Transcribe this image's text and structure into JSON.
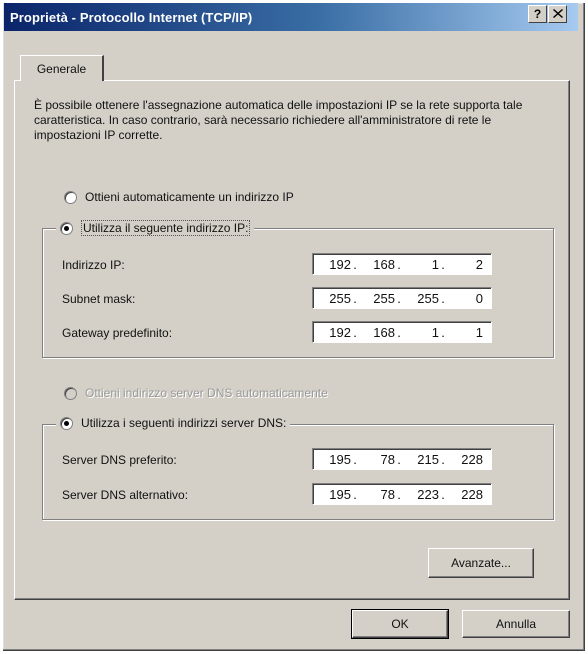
{
  "window": {
    "title": "Proprietà - Protocollo Internet (TCP/IP)",
    "help_label": "?",
    "close_label": "X"
  },
  "tabs": [
    {
      "label": "Generale"
    }
  ],
  "description": "È possibile ottenere l'assegnazione automatica delle impostazioni IP se la rete supporta tale caratteristica. In caso contrario, sarà necessario richiedere all'amministratore di rete le impostazioni IP corrette.",
  "ip": {
    "auto_option": "Ottieni automaticamente un indirizzo IP",
    "manual_option": "Utilizza il seguente indirizzo IP:",
    "selected": "manual",
    "fields": [
      {
        "label": "Indirizzo IP:",
        "octets": [
          "192",
          "168",
          "1",
          "2"
        ]
      },
      {
        "label": "Subnet mask:",
        "octets": [
          "255",
          "255",
          "255",
          "0"
        ]
      },
      {
        "label": "Gateway predefinito:",
        "octets": [
          "192",
          "168",
          "1",
          "1"
        ]
      }
    ]
  },
  "dns": {
    "auto_option": "Ottieni indirizzo server DNS automaticamente",
    "manual_option": "Utilizza i seguenti indirizzi server DNS:",
    "selected": "manual",
    "fields": [
      {
        "label": "Server DNS preferito:",
        "octets": [
          "195",
          "78",
          "215",
          "228"
        ]
      },
      {
        "label": "Server DNS alternativo:",
        "octets": [
          "195",
          "78",
          "223",
          "228"
        ]
      }
    ]
  },
  "buttons": {
    "advanced": "Avanzate...",
    "ok": "OK",
    "cancel": "Annulla"
  }
}
